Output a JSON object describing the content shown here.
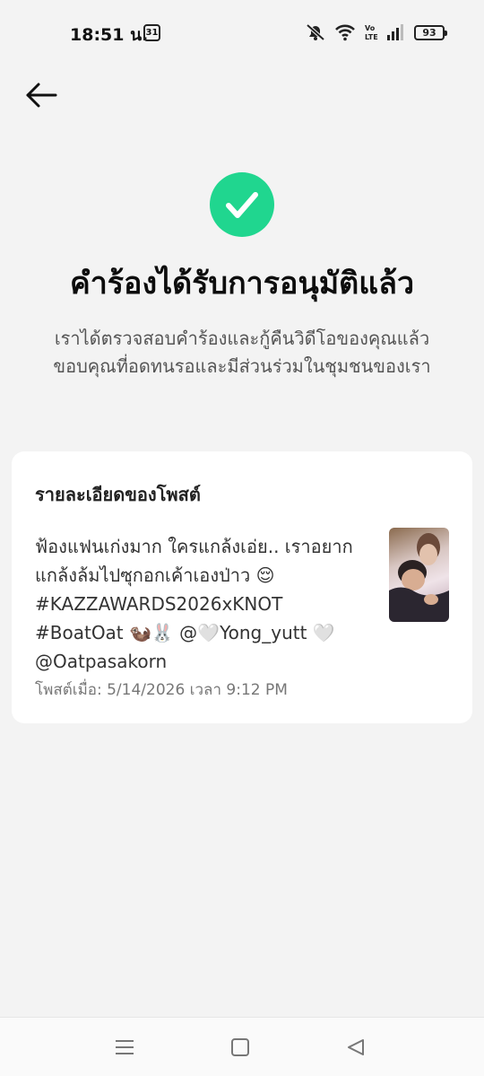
{
  "status_bar": {
    "time": "18:51 น.",
    "calendar_day": "31",
    "battery": "93"
  },
  "page": {
    "title": "คำร้องได้รับการอนุมัติแล้ว",
    "description": "เราได้ตรวจสอบคำร้องและกู้คืนวิดีโอของคุณแล้ว ขอบคุณที่อดทนรอและมีส่วนร่วมในชุมชนของเรา",
    "accent_color": "#20d68f"
  },
  "post_card": {
    "heading": "รายละเอียดของโพสต์",
    "text": "ฟ้องแฟนเก่งมาก ใครแกล้งเอ่ย.. เราอยากแกล้งล้มไปซุกอกเค้าเองป่าว 😌 #KAZZAWARDS2026xKNOT #BoatOat 🦦🐰 @🤍Yong_yutt 🤍 @Oatpasakorn",
    "posted_at": "โพสต์เมื่อ: 5/14/2026 เวลา 9:12 PM"
  },
  "icons": {
    "back": "arrow-left-icon",
    "success": "check-circle-icon",
    "nav_menu": "menu-icon",
    "nav_home": "square-icon",
    "nav_back": "triangle-back-icon"
  }
}
